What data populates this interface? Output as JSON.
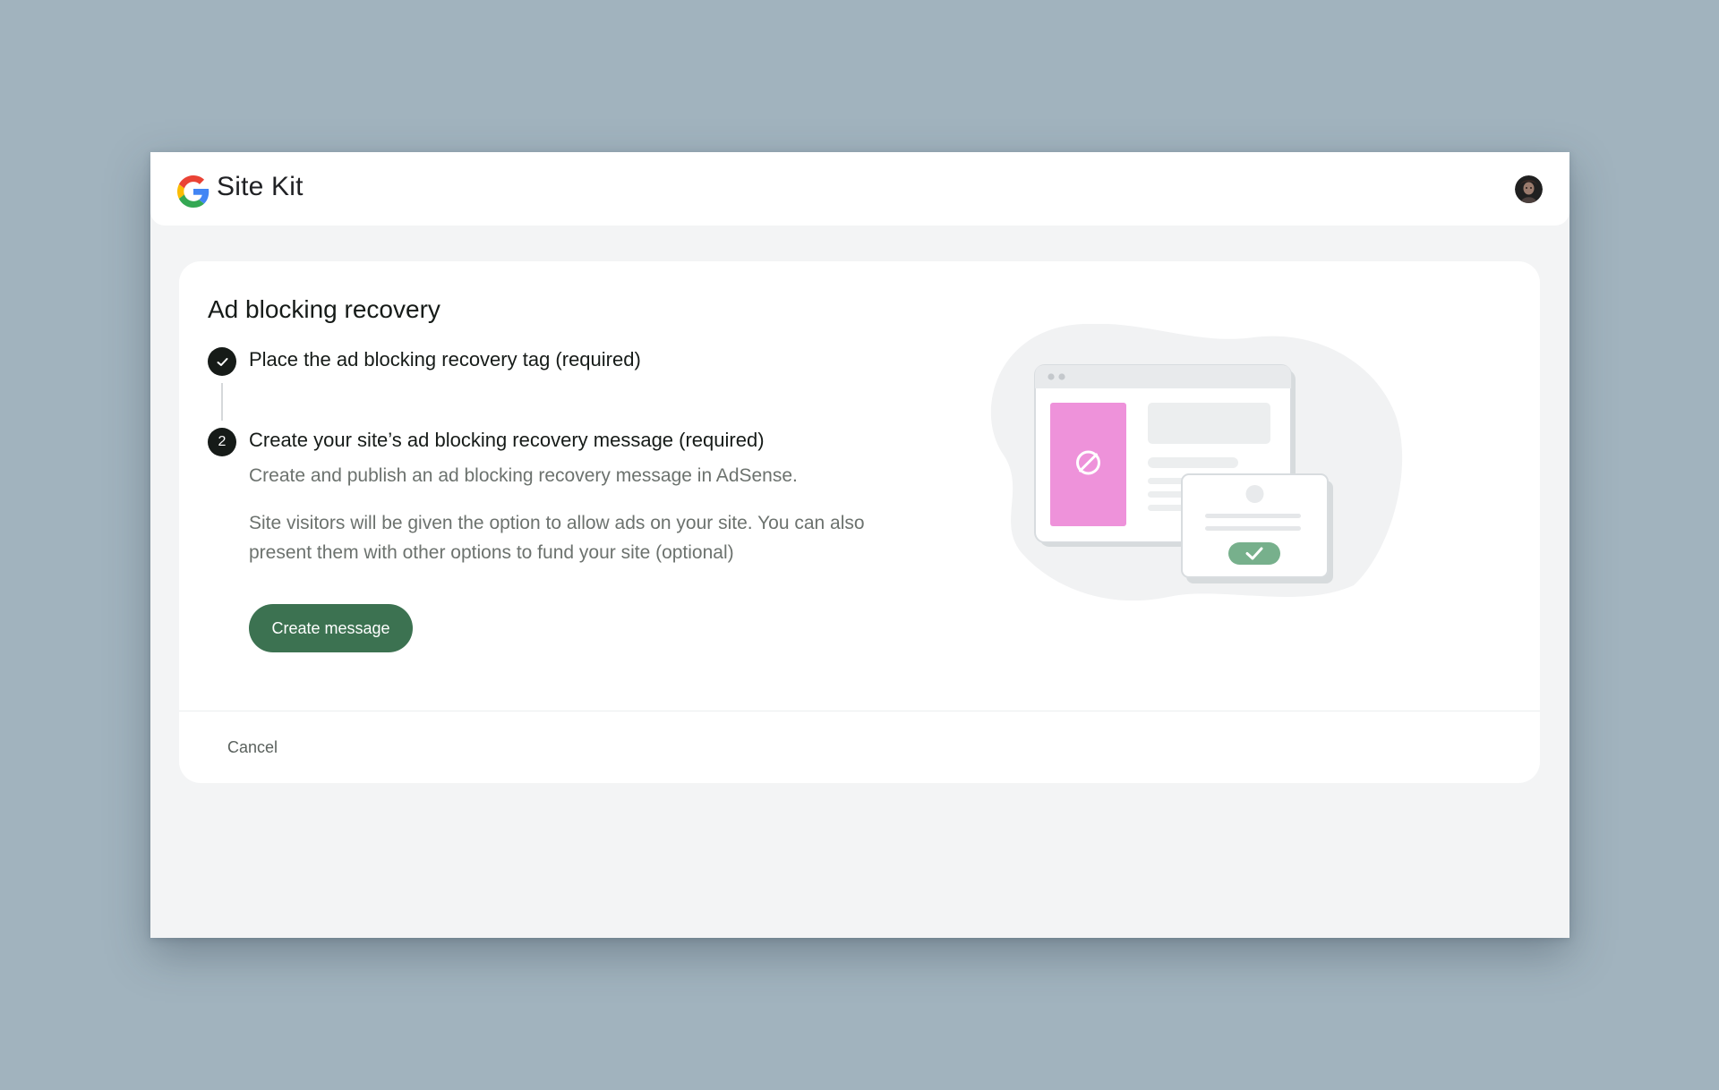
{
  "app": {
    "title": "Site Kit",
    "logo_icon": "google-g-icon",
    "avatar_icon": "user-avatar-icon"
  },
  "card": {
    "title": "Ad blocking recovery",
    "steps": [
      {
        "status": "complete",
        "marker_icon": "check-icon",
        "title": "Place the ad blocking recovery tag (required)"
      },
      {
        "status": "active",
        "number": "2",
        "title": "Create your site’s ad blocking recovery message (required)",
        "description": "Create and publish an ad blocking recovery message in AdSense.",
        "details": "Site visitors will be given the option to allow ads on your site. You can also present them with other options to fund your site (optional)"
      }
    ],
    "primary_button_label": "Create message",
    "cancel_label": "Cancel"
  },
  "illustration": {
    "name": "ad-blocking-recovery-illustration",
    "blocked_icon": "block-icon",
    "check_icon": "check-icon"
  },
  "colors": {
    "background": "#a1b3be",
    "primary_button": "#3c7251",
    "step_marker": "#161b18",
    "blocked_panel": "#ee92da",
    "approval_badge": "#77b08c"
  }
}
